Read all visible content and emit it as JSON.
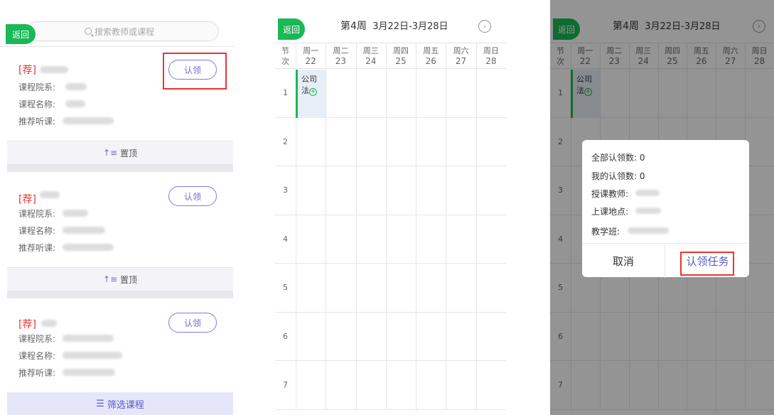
{
  "panel1": {
    "back_label": "返回",
    "search_placeholder": "搜索教师或课程",
    "cards": [
      {
        "tag": "[荐]",
        "dept_label": "课程院系:",
        "course_label": "课程名称:",
        "listen_label": "推荐听课:",
        "claim_label": "认领"
      },
      {
        "tag": "[荐]",
        "dept_label": "课程院系:",
        "course_label": "课程名称:",
        "listen_label": "推荐听课:",
        "claim_label": "认领"
      },
      {
        "tag": "[荐]",
        "dept_label": "课程院系:",
        "course_label": "课程名称:",
        "listen_label": "推荐听课:",
        "claim_label": "认领"
      }
    ],
    "pin_label": "置顶",
    "filter_label": "筛选课程"
  },
  "schedule": {
    "back_label": "返回",
    "week_title": "第4周",
    "date_range": "3月22日-3月28日",
    "period_header": [
      "节",
      "次"
    ],
    "days": [
      {
        "name": "周一",
        "date": "22"
      },
      {
        "name": "周二",
        "date": "23"
      },
      {
        "name": "周三",
        "date": "24"
      },
      {
        "name": "周四",
        "date": "25"
      },
      {
        "name": "周五",
        "date": "26"
      },
      {
        "name": "周六",
        "date": "27"
      },
      {
        "name": "周日",
        "date": "28"
      }
    ],
    "periods": [
      "1",
      "2",
      "3",
      "4",
      "5",
      "6",
      "7"
    ],
    "course": {
      "line1": "公司",
      "line2": "法"
    }
  },
  "dialog": {
    "all_claims": "全部认领数: 0",
    "my_claims": "我的认领数: 0",
    "teacher_label": "授课教师:",
    "location_label": "上课地点:",
    "class_label": "教学班:",
    "cancel_label": "取消",
    "confirm_label": "认领任务"
  }
}
